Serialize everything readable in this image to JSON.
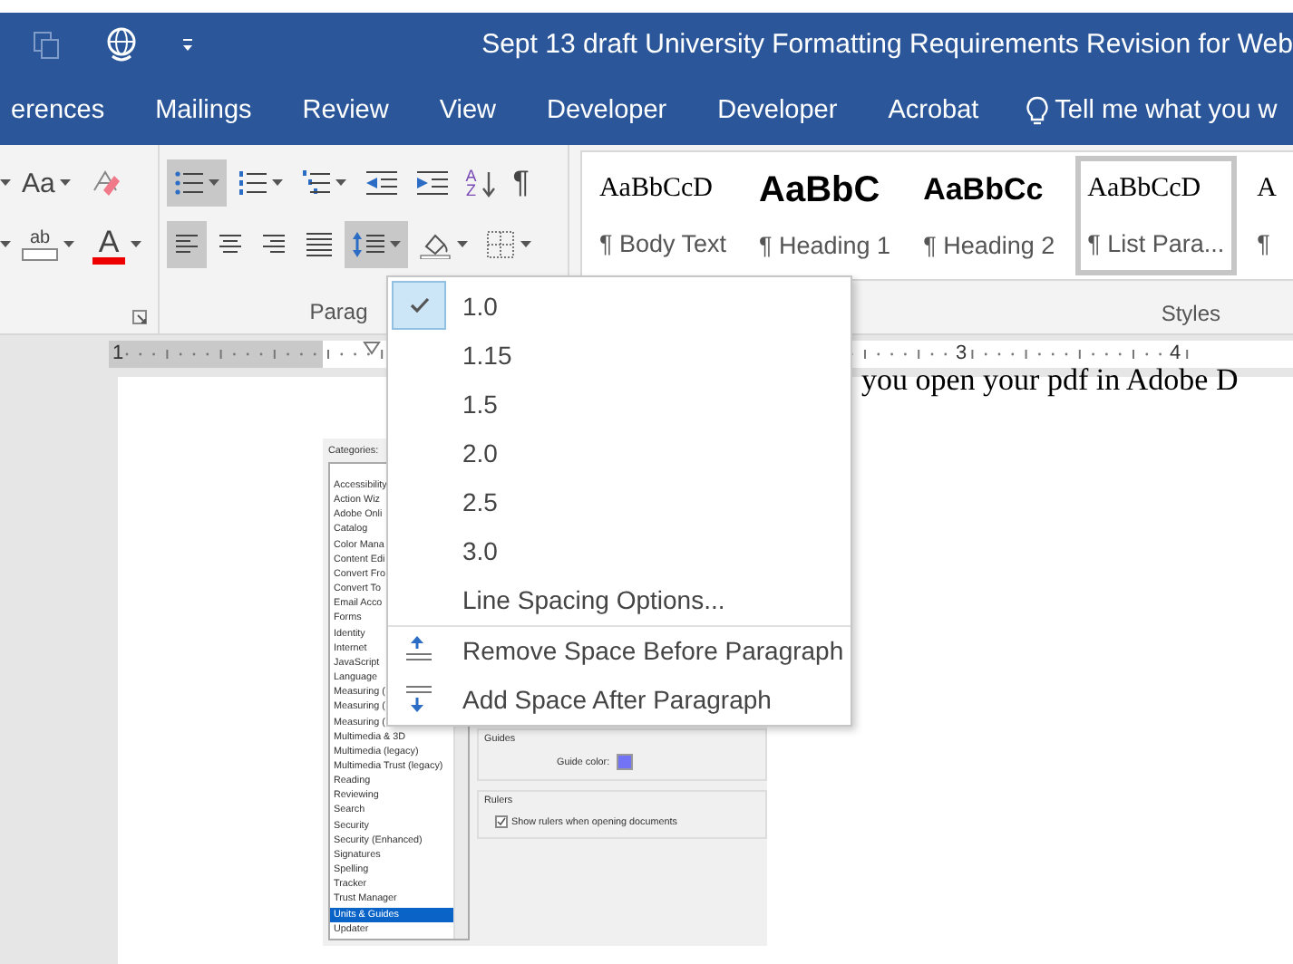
{
  "title_bar": {
    "title": "Sept 13 draft University Formatting Requirements Revision for Web"
  },
  "tabs": [
    {
      "label": "erences",
      "selected": false
    },
    {
      "label": "Mailings",
      "selected": false
    },
    {
      "label": "Review",
      "selected": false
    },
    {
      "label": "View",
      "selected": false
    },
    {
      "label": "Developer",
      "selected": false
    },
    {
      "label": "Developer",
      "selected": false
    },
    {
      "label": "Acrobat",
      "selected": false
    }
  ],
  "tell_me": "Tell me what you w",
  "font_group": {
    "row1": [
      {
        "kind": "caret",
        "pressed": false
      },
      {
        "kind": "change-case",
        "label": "Aa",
        "dropdown": true,
        "pressed": false
      },
      {
        "kind": "clear-format",
        "dropdown": false,
        "pressed": false
      }
    ],
    "row2": [
      {
        "kind": "caret",
        "pressed": false
      },
      {
        "kind": "highlight",
        "label": "ab",
        "dropdown": true,
        "pressed": false
      },
      {
        "kind": "font-color",
        "label": "A",
        "dropdown": true,
        "pressed": false
      }
    ]
  },
  "paragraph_group": {
    "label": "Parag",
    "row1": [
      {
        "kind": "bullets",
        "dropdown": true,
        "pressed": true
      },
      {
        "kind": "numbering",
        "dropdown": true,
        "pressed": false
      },
      {
        "kind": "multilevel",
        "dropdown": true,
        "pressed": false
      },
      {
        "kind": "outdent",
        "dropdown": false,
        "pressed": false
      },
      {
        "kind": "indent",
        "dropdown": false,
        "pressed": false
      },
      {
        "kind": "sort",
        "label": "AZ",
        "dropdown": false,
        "pressed": false
      },
      {
        "kind": "pilcrow",
        "label": "¶",
        "dropdown": false,
        "pressed": false
      }
    ],
    "row2": [
      {
        "kind": "align-left",
        "dropdown": false,
        "pressed": true
      },
      {
        "kind": "align-center",
        "dropdown": false,
        "pressed": false
      },
      {
        "kind": "align-right",
        "dropdown": false,
        "pressed": false
      },
      {
        "kind": "justify",
        "dropdown": false,
        "pressed": false
      },
      {
        "kind": "line-spacing",
        "dropdown": true,
        "pressed": true
      },
      {
        "kind": "shading",
        "dropdown": true,
        "pressed": false
      },
      {
        "kind": "borders",
        "dropdown": true,
        "pressed": false
      }
    ]
  },
  "styles_group": {
    "label": "Styles",
    "items": [
      {
        "kind": "serif",
        "preview": "AaBbCcD",
        "name": "¶ Body Text",
        "selected": false
      },
      {
        "kind": "heading1",
        "preview": "AaBbC",
        "name": "¶ Heading 1",
        "selected": false
      },
      {
        "kind": "heading2",
        "preview": "AaBbCc",
        "name": "¶ Heading 2",
        "selected": false
      },
      {
        "kind": "serif",
        "preview": "AaBbCcD",
        "name": "¶ List Para...",
        "selected": true
      },
      {
        "kind": "serif",
        "preview": "A",
        "name": "¶",
        "selected": false
      }
    ]
  },
  "ruler": {
    "numbers": [
      "1",
      "3",
      "4"
    ]
  },
  "document": {
    "text": "you open your pdf in Adobe D",
    "screenshot": {
      "categories_label": "Categories:",
      "categories": [
        {
          "label": "Accessibility",
          "selected": false
        },
        {
          "label": "Action Wiz",
          "selected": false
        },
        {
          "label": "Adobe Onli",
          "selected": false
        },
        {
          "label": "Catalog",
          "selected": false
        },
        {
          "label": "Color Mana",
          "selected": false
        },
        {
          "label": "Content Edi",
          "selected": false
        },
        {
          "label": "Convert Fro",
          "selected": false
        },
        {
          "label": "Convert To",
          "selected": false
        },
        {
          "label": "Email Acco",
          "selected": false
        },
        {
          "label": "Forms",
          "selected": false
        },
        {
          "label": "Identity",
          "selected": false
        },
        {
          "label": "Internet",
          "selected": false
        },
        {
          "label": "JavaScript",
          "selected": false
        },
        {
          "label": "Language",
          "selected": false
        },
        {
          "label": "Measuring (",
          "selected": false
        },
        {
          "label": "Measuring (",
          "selected": false
        },
        {
          "label": "Measuring (",
          "selected": false
        },
        {
          "label": "Multimedia & 3D",
          "selected": false
        },
        {
          "label": "Multimedia (legacy)",
          "selected": false
        },
        {
          "label": "Multimedia Trust (legacy)",
          "selected": false
        },
        {
          "label": "Reading",
          "selected": false
        },
        {
          "label": "Reviewing",
          "selected": false
        },
        {
          "label": "Search",
          "selected": false
        },
        {
          "label": "Security",
          "selected": false
        },
        {
          "label": "Security (Enhanced)",
          "selected": false
        },
        {
          "label": "Signatures",
          "selected": false
        },
        {
          "label": "Spelling",
          "selected": false
        },
        {
          "label": "Tracker",
          "selected": false
        },
        {
          "label": "Trust Manager",
          "selected": false
        },
        {
          "label": "Units & Guides",
          "selected": true
        },
        {
          "label": "Updater",
          "selected": false
        }
      ],
      "guides_label": "Guides",
      "guide_color_label": "Guide color:",
      "rulers_label": "Rulers",
      "show_rulers": {
        "label": "Show rulers when opening documents",
        "checked": true
      }
    }
  },
  "line_spacing_menu": {
    "items": [
      {
        "kind": "spacing",
        "label": "1.0",
        "checked": true
      },
      {
        "kind": "spacing",
        "label": "1.15",
        "checked": false
      },
      {
        "kind": "spacing",
        "label": "1.5",
        "checked": false
      },
      {
        "kind": "spacing",
        "label": "2.0",
        "checked": false
      },
      {
        "kind": "spacing",
        "label": "2.5",
        "checked": false
      },
      {
        "kind": "spacing",
        "label": "3.0",
        "checked": false
      },
      {
        "kind": "option",
        "label": "Line Spacing Options..."
      },
      {
        "kind": "remove-before",
        "label": "Remove Space Before Paragraph"
      },
      {
        "kind": "add-after",
        "label": "Add Space After Paragraph"
      }
    ]
  }
}
